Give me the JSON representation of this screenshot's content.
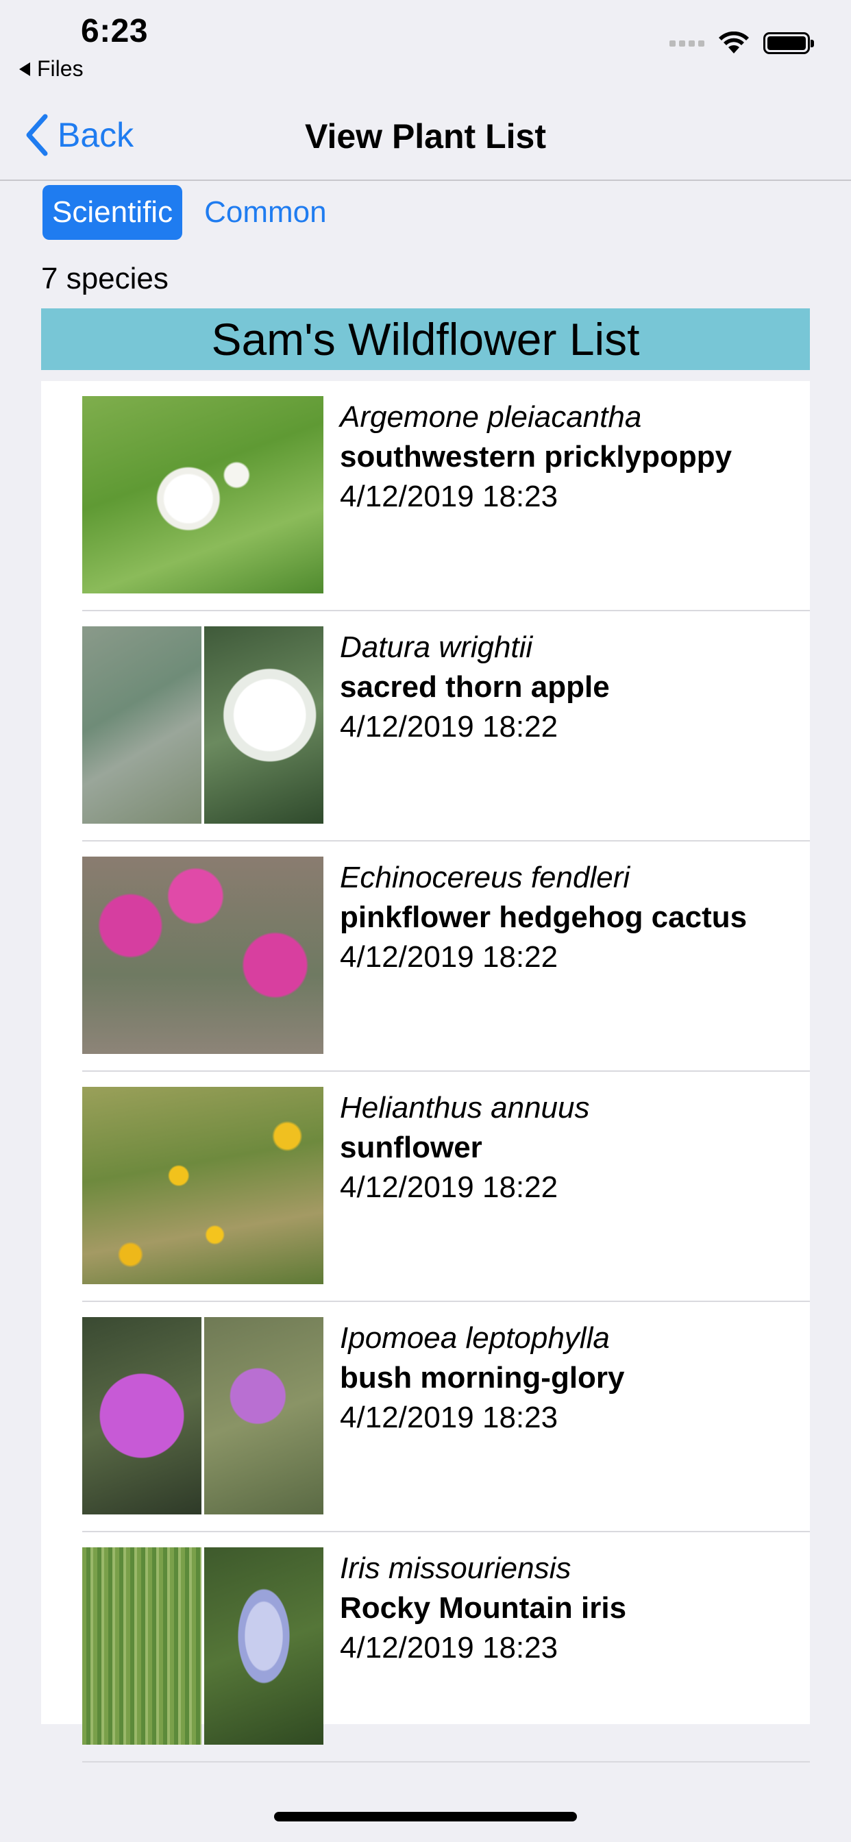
{
  "status": {
    "time": "6:23",
    "back_app": "Files"
  },
  "nav": {
    "back_label": "Back",
    "title": "View Plant List"
  },
  "toggle": {
    "options": [
      "Scientific",
      "Common"
    ],
    "selected": "Scientific"
  },
  "species_count": "7 species",
  "list_title": "Sam's Wildflower List",
  "plants": [
    {
      "scientific": "Argemone pleiacantha",
      "common": "southwestern pricklypoppy",
      "datetime": "4/12/2019 18:23"
    },
    {
      "scientific": "Datura wrightii",
      "common": "sacred thorn apple",
      "datetime": "4/12/2019 18:22"
    },
    {
      "scientific": "Echinocereus fendleri",
      "common": "pinkflower hedgehog cactus",
      "datetime": "4/12/2019 18:22"
    },
    {
      "scientific": "Helianthus annuus",
      "common": "sunflower",
      "datetime": "4/12/2019 18:22"
    },
    {
      "scientific": "Ipomoea leptophylla",
      "common": "bush morning-glory",
      "datetime": "4/12/2019 18:23"
    },
    {
      "scientific": "Iris missouriensis",
      "common": "Rocky Mountain iris",
      "datetime": "4/12/2019 18:23"
    }
  ],
  "colors": {
    "accent": "#1f7cf0",
    "header_bg": "#78c6d6",
    "page_bg": "#efeff4"
  }
}
